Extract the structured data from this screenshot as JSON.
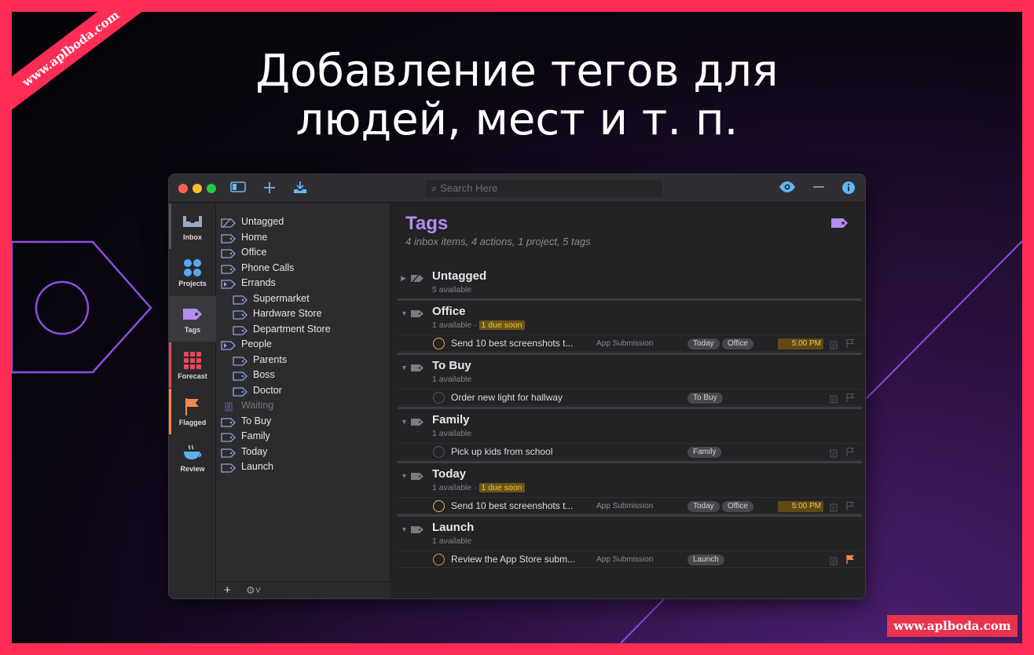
{
  "promo": {
    "headline_line1": "Добавление тегов для",
    "headline_line2": "людей, мест и т. п.",
    "watermark_corner": "www.aplboda.com",
    "watermark_badge": "www.aplboda.com"
  },
  "window": {
    "search_placeholder": "Search Here"
  },
  "sidebar": [
    {
      "label": "Inbox",
      "icon": "inbox-icon",
      "color": "#9aa8c8"
    },
    {
      "label": "Projects",
      "icon": "projects-icon",
      "color": "#58a8f0"
    },
    {
      "label": "Tags",
      "icon": "tag-icon",
      "color": "#b58cf0",
      "selected": true
    },
    {
      "label": "Forecast",
      "icon": "forecast-icon",
      "color": "#e8485a"
    },
    {
      "label": "Flagged",
      "icon": "flag-icon",
      "color": "#f08a4b"
    },
    {
      "label": "Review",
      "icon": "review-icon",
      "color": "#5fb0e8"
    }
  ],
  "tags": [
    {
      "label": "Untagged",
      "indent": 0,
      "icon": "untagged-tag-icon"
    },
    {
      "label": "Home",
      "indent": 0,
      "icon": "tag-icon"
    },
    {
      "label": "Office",
      "indent": 0,
      "icon": "tag-icon"
    },
    {
      "label": "Phone Calls",
      "indent": 0,
      "icon": "tag-icon"
    },
    {
      "label": "Errands",
      "indent": 0,
      "icon": "tag-group-icon"
    },
    {
      "label": "Supermarket",
      "indent": 1,
      "icon": "tag-icon"
    },
    {
      "label": "Hardware Store",
      "indent": 1,
      "icon": "tag-icon"
    },
    {
      "label": "Department Store",
      "indent": 1,
      "icon": "tag-icon"
    },
    {
      "label": "People",
      "indent": 0,
      "icon": "tag-group-icon"
    },
    {
      "label": "Parents",
      "indent": 1,
      "icon": "tag-icon"
    },
    {
      "label": "Boss",
      "indent": 1,
      "icon": "tag-icon"
    },
    {
      "label": "Doctor",
      "indent": 1,
      "icon": "tag-icon"
    },
    {
      "label": "Waiting",
      "indent": 0,
      "icon": "pause-icon",
      "dim": true
    },
    {
      "label": "To Buy",
      "indent": 0,
      "icon": "tag-icon"
    },
    {
      "label": "Family",
      "indent": 0,
      "icon": "tag-icon"
    },
    {
      "label": "Today",
      "indent": 0,
      "icon": "tag-icon"
    },
    {
      "label": "Launch",
      "indent": 0,
      "icon": "tag-icon"
    }
  ],
  "main": {
    "title": "Tags",
    "subtitle": "4 inbox items, 4 actions, 1 project, 5 tags",
    "groups": [
      {
        "name": "Untagged",
        "meta": "5 available",
        "due": "",
        "tasks": []
      },
      {
        "name": "Office",
        "meta": "1 available · ",
        "due": "1 due soon",
        "tasks": [
          {
            "name": "Send 10 best screenshots t...",
            "project": "App Submission",
            "tags": [
              "Today",
              "Office"
            ],
            "time": "5:00 PM",
            "state": "due",
            "flagged": false
          }
        ]
      },
      {
        "name": "To Buy",
        "meta": "1 available",
        "due": "",
        "tasks": [
          {
            "name": "Order new light for hallway",
            "project": "",
            "tags": [
              "To Buy"
            ],
            "time": "",
            "state": "normal",
            "flagged": false
          }
        ]
      },
      {
        "name": "Family",
        "meta": "1 available",
        "due": "",
        "tasks": [
          {
            "name": "Pick up kids from school",
            "project": "",
            "tags": [
              "Family"
            ],
            "time": "",
            "state": "normal",
            "flagged": false
          }
        ]
      },
      {
        "name": "Today",
        "meta": "1 available · ",
        "due": "1 due soon",
        "tasks": [
          {
            "name": "Send 10 best screenshots t...",
            "project": "App Submission",
            "tags": [
              "Today",
              "Office"
            ],
            "time": "5:00 PM",
            "state": "due",
            "flagged": false
          }
        ]
      },
      {
        "name": "Launch",
        "meta": "1 available",
        "due": "",
        "tasks": [
          {
            "name": "Review the App Store subm...",
            "project": "App Submission",
            "tags": [
              "Launch"
            ],
            "time": "",
            "state": "flag",
            "flagged": true
          }
        ]
      }
    ]
  },
  "colors": {
    "accent_purple": "#b58cf0",
    "toolbar_blue": "#62b8f4",
    "due_yellow": "#f4c34a",
    "flag_orange": "#f08a4b",
    "frame_pink": "#ff2d55"
  }
}
